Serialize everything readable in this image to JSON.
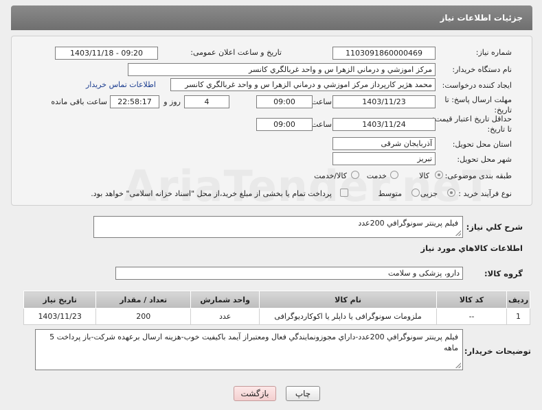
{
  "header": {
    "title": "جزئیات اطلاعات نیاز"
  },
  "fields": {
    "need_number_label": "شماره نیاز:",
    "need_number": "1103091860000469",
    "announce_label": "تاریخ و ساعت اعلان عمومی:",
    "announce_value": "1403/11/18 - 09:20",
    "buyer_org_label": "نام دستگاه خریدار:",
    "buyer_org": "مرکز اموزشي و درماني الزهرا س  و واحد غربالگري کانسر",
    "creator_label": "ایجاد کننده درخواست:",
    "creator": "محمد هژير کارپرداز مرکز اموزشي و درماني الزهرا س  و واحد غربالگري کانسر",
    "contact_link": "اطلاعات تماس خریدار",
    "reply_deadline_label": "مهلت ارسال پاسخ: تا تاریخ:",
    "reply_date": "1403/11/23",
    "time_label": "ساعت",
    "reply_time": "09:00",
    "days_value": "4",
    "days_label": "روز و",
    "remaining_time": "22:58:17",
    "remaining_label": "ساعت باقی مانده",
    "price_validity_label": "حداقل تاریخ اعتبار قیمت: تا تاریخ:",
    "price_date": "1403/11/24",
    "price_time": "09:00",
    "province_label": "استان محل تحویل:",
    "province": "آذربایجان شرقی",
    "city_label": "شهر محل تحویل:",
    "city": "تبریز",
    "category_label": "طبقه بندی موضوعی:",
    "category_options": [
      "کالا",
      "خدمت",
      "کالا/خدمت"
    ],
    "process_label": "نوع فرآیند خرید :",
    "process_options": [
      "جزیی",
      "متوسط"
    ],
    "payment_note": "پرداخت تمام یا بخشی از مبلغ خرید،از محل \"اسناد خزانه اسلامی\" خواهد بود."
  },
  "description": {
    "label": "شرح کلي نياز:",
    "value": "فيلم پرينتر سونوگرافي 200عدد"
  },
  "goods_info_title": "اطلاعات کالاهاي مورد نياز",
  "goods_group": {
    "label": "گروه کالا:",
    "value": "دارو، پزشکی و سلامت"
  },
  "table": {
    "headers": [
      "ردیف",
      "کد کالا",
      "نام کالا",
      "واحد شمارش",
      "تعداد / مقدار",
      "تاریخ نیاز"
    ],
    "rows": [
      [
        "1",
        "--",
        "ملزومات سونوگرافی یا داپلر یا اکوکاردیوگرافی",
        "عدد",
        "200",
        "1403/11/23"
      ]
    ]
  },
  "buyer_notes": {
    "label": "توضیحات خریدار:",
    "value": "فيلم پرينتر سونوگرافي 200عدد-داراي مجوزونمايندگي فعال ومعتبراز آيمد باکيفيت خوب-هزينه ارسال برعهده شرکت-باز پرداخت 5 ماهه"
  },
  "buttons": {
    "print": "چاپ",
    "back": "بازگشت"
  },
  "watermark": "AriaTender.neT"
}
